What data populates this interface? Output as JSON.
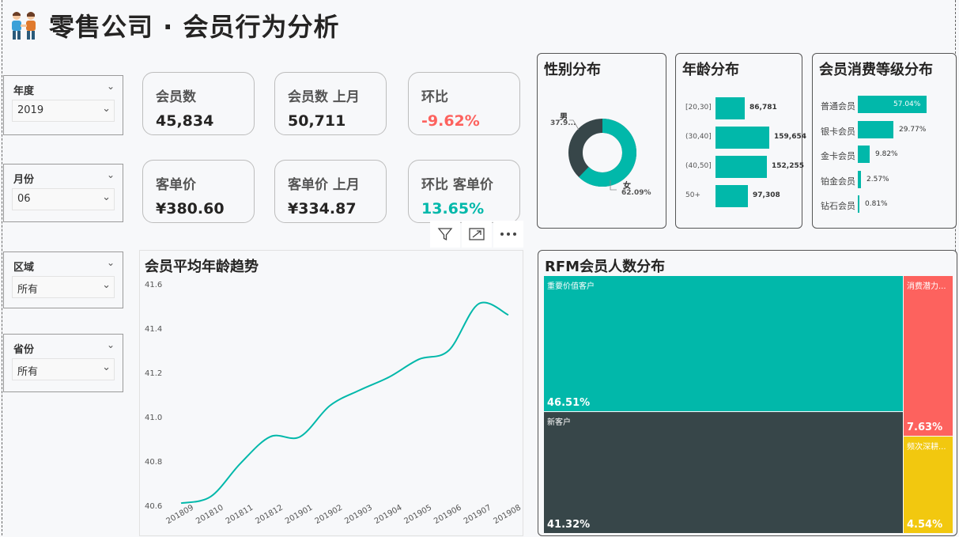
{
  "header": {
    "title": "零售公司 · 会员行为分析",
    "logo_icon": "people-holding-hands-icon"
  },
  "slicers": [
    {
      "label": "年度",
      "value": "2019"
    },
    {
      "label": "月份",
      "value": "06"
    },
    {
      "label": "区域",
      "value": "所有"
    },
    {
      "label": "省份",
      "value": "所有"
    }
  ],
  "kpis": [
    {
      "label": "会员数",
      "value": "45,834",
      "color": "#252423"
    },
    {
      "label": "会员数 上月",
      "value": "50,711",
      "color": "#252423"
    },
    {
      "label": "环比",
      "value": "-9.62%",
      "color": "#fd625e"
    },
    {
      "label": "客单价",
      "value": "¥380.60",
      "color": "#252423"
    },
    {
      "label": "客单价 上月",
      "value": "¥334.87",
      "color": "#252423"
    },
    {
      "label": "环比 客单价",
      "value": "13.65%",
      "color": "#01b8aa"
    }
  ],
  "colors": {
    "teal": "#01b8aa",
    "dark": "#374649",
    "red": "#fd625e",
    "yellow": "#f2c80f"
  },
  "gender": {
    "title": "性别分布",
    "male_label": "男",
    "male_value": "37.9...",
    "female_label": "女",
    "female_value": "62.09%",
    "female_pct": 62.09
  },
  "age": {
    "title": "年龄分布",
    "rows": [
      {
        "label": "[20,30]",
        "value": "86,781",
        "n": 86781
      },
      {
        "label": "(30,40]",
        "value": "159,654",
        "n": 159654
      },
      {
        "label": "(40,50]",
        "value": "152,255",
        "n": 152255
      },
      {
        "label": "50+",
        "value": "97,308",
        "n": 97308
      }
    ]
  },
  "levels": {
    "title": "会员消费等级分布",
    "rows": [
      {
        "label": "普通会员",
        "value": "57.04%",
        "pct": 57.04
      },
      {
        "label": "银卡会员",
        "value": "29.77%",
        "pct": 29.77
      },
      {
        "label": "金卡会员",
        "value": "9.82%",
        "pct": 9.82
      },
      {
        "label": "铂金会员",
        "value": "2.57%",
        "pct": 2.57
      },
      {
        "label": "钻石会员",
        "value": "0.81%",
        "pct": 0.81
      }
    ]
  },
  "toolbar": {
    "filter_icon": "filter-icon",
    "focus_icon": "focus-mode-icon",
    "more_icon": "more-options-icon"
  },
  "chart_data": {
    "type": "line",
    "title": "会员平均年龄趋势",
    "x": [
      "201809",
      "201810",
      "201811",
      "201812",
      "201901",
      "201902",
      "201903",
      "201904",
      "201905",
      "201906",
      "201907",
      "201908"
    ],
    "values": [
      40.61,
      40.64,
      40.79,
      40.91,
      40.91,
      41.05,
      41.12,
      41.18,
      41.26,
      41.3,
      41.51,
      41.46
    ],
    "yticks": [
      "40.6",
      "40.8",
      "41.0",
      "41.2",
      "41.4",
      "41.6"
    ],
    "ylim": [
      40.6,
      41.6
    ],
    "grid": false,
    "color": "#01b8aa"
  },
  "rfm": {
    "title": "RFM会员人数分布",
    "cells": [
      {
        "name": "重要价值客户",
        "pct": "46.51%"
      },
      {
        "name": "新客户",
        "pct": "41.32%"
      },
      {
        "name": "消费潜力...",
        "pct": "7.63%"
      },
      {
        "name": "频次深耕...",
        "pct": "4.54%"
      }
    ]
  }
}
